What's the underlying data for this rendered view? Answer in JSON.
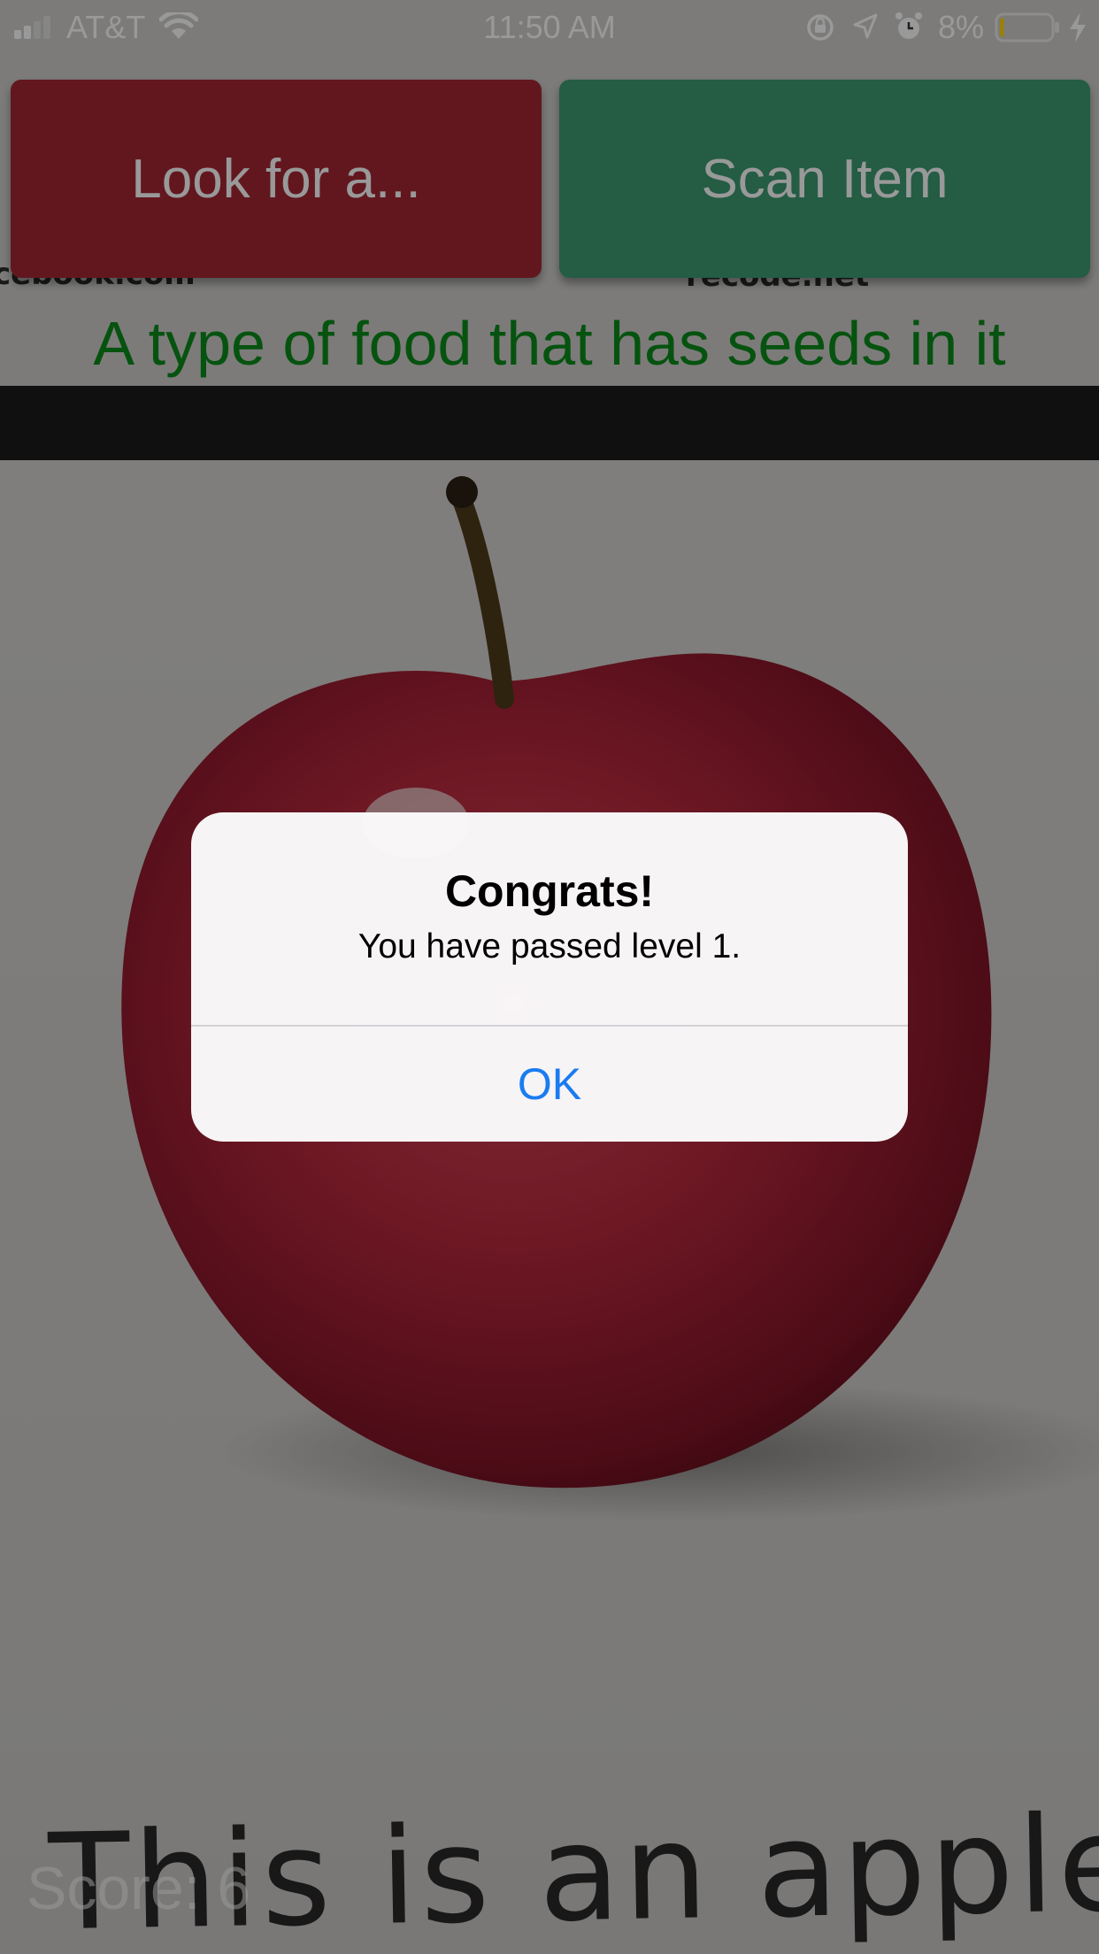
{
  "status_bar": {
    "carrier": "AT&T",
    "time": "11:50 AM",
    "battery_percent": "8%",
    "signal_bars": 2,
    "battery_level": 0.08,
    "icons": [
      "signal-icon",
      "wifi-icon",
      "orientation-lock-icon",
      "location-icon",
      "alarm-icon",
      "battery-icon",
      "charging-icon"
    ]
  },
  "buttons": {
    "look_for_label": "Look for a...",
    "scan_item_label": "Scan Item"
  },
  "hint_text": "A type of food that has seeds in it",
  "score_text": "Score: 6",
  "camera_view": {
    "caption_text": "This is an apple.",
    "fragment_left": "cebook.com",
    "fragment_right": "recode.net"
  },
  "alert": {
    "title": "Congrats!",
    "message": "You have passed level 1.",
    "ok_label": "OK"
  },
  "colors": {
    "look_button": "#a32733",
    "scan_button": "#3d9a72",
    "hint_text": "#0b8a1a",
    "alert_action": "#1a7cf0",
    "battery_low": "#ffd60a"
  }
}
